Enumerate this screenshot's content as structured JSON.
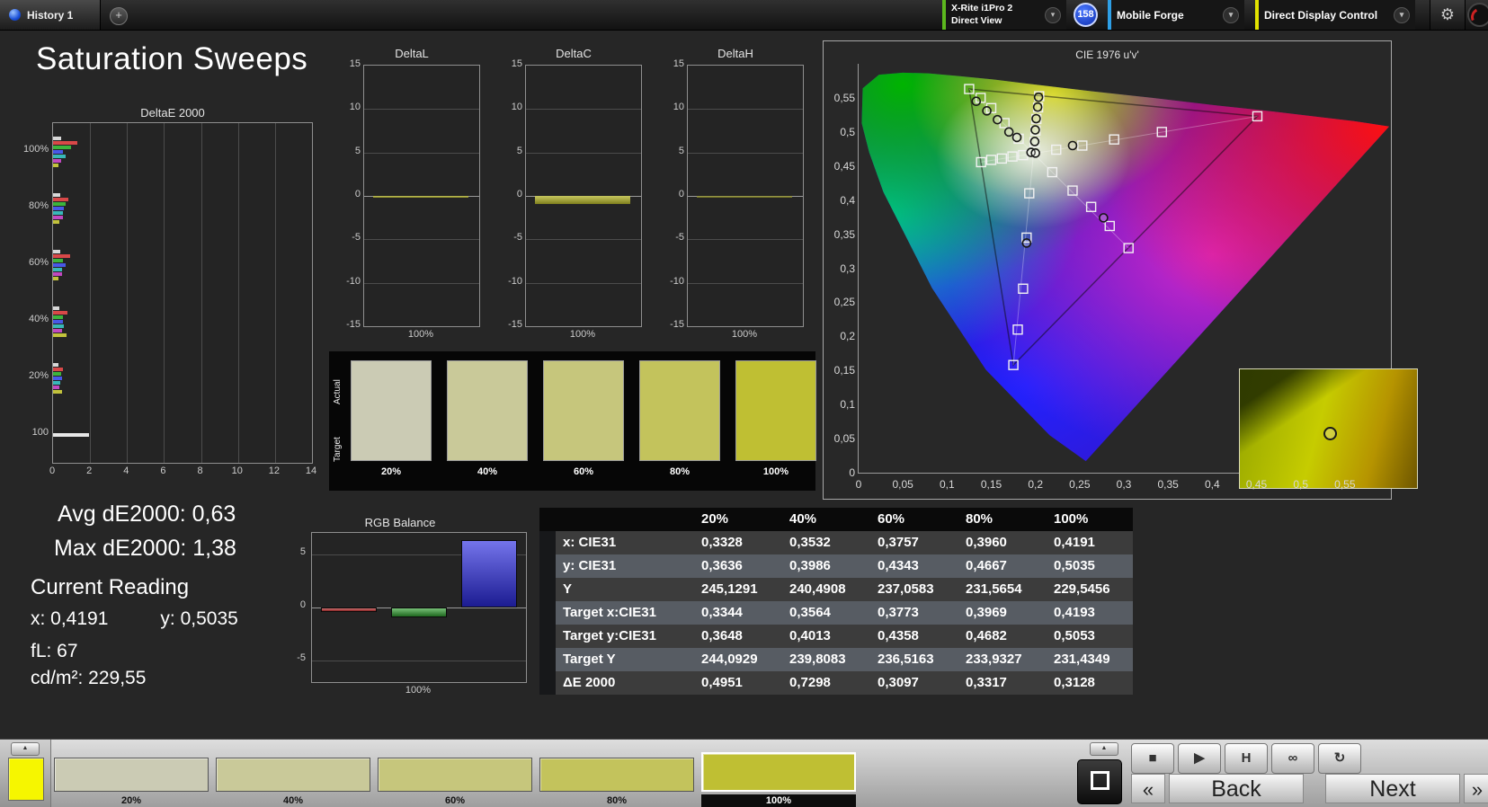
{
  "topbar": {
    "history_tab": "History 1",
    "add_tab_label": "+",
    "dropdown_chevron": "▾",
    "meter_dropdown": {
      "line1": "X-Rite i1Pro 2",
      "line2": "Direct View",
      "accent": "#5cb81e"
    },
    "reading_badge": "158",
    "source_dropdown": {
      "label": "Mobile Forge",
      "accent": "#2e9fe6"
    },
    "control_dropdown": {
      "label": "Direct Display Control",
      "accent": "#e3e300"
    },
    "gear_icon": "⚙"
  },
  "page_title": "Saturation Sweeps",
  "readings": {
    "avg": "Avg dE2000: 0,63",
    "max": "Max dE2000: 1,38",
    "heading": "Current Reading",
    "x": "x: 0,4191",
    "y": "y: 0,5035",
    "fl": "fL: 67",
    "cdm2": "cd/m²: 229,55"
  },
  "saturation_swatches": {
    "actual_label": "Actual",
    "target_label": "Target",
    "labels": [
      "20%",
      "40%",
      "60%",
      "80%",
      "100%"
    ],
    "colors": [
      "#cbcbb4",
      "#c9c999",
      "#c6c67c",
      "#c3c35c",
      "#bfbf33"
    ]
  },
  "results_table": {
    "headers": [
      "20%",
      "40%",
      "60%",
      "80%",
      "100%"
    ],
    "rows": [
      {
        "label": "x: CIE31",
        "values": [
          "0,3328",
          "0,3532",
          "0,3757",
          "0,3960",
          "0,4191"
        ]
      },
      {
        "label": "y: CIE31",
        "values": [
          "0,3636",
          "0,3986",
          "0,4343",
          "0,4667",
          "0,5035"
        ]
      },
      {
        "label": "Y",
        "values": [
          "245,1291",
          "240,4908",
          "237,0583",
          "231,5654",
          "229,5456"
        ]
      },
      {
        "label": "Target x:CIE31",
        "values": [
          "0,3344",
          "0,3564",
          "0,3773",
          "0,3969",
          "0,4193"
        ]
      },
      {
        "label": "Target y:CIE31",
        "values": [
          "0,3648",
          "0,4013",
          "0,4358",
          "0,4682",
          "0,5053"
        ]
      },
      {
        "label": "Target Y",
        "values": [
          "244,0929",
          "239,8083",
          "236,5163",
          "233,9327",
          "231,4349"
        ]
      },
      {
        "label": "ΔE 2000",
        "values": [
          "0,4951",
          "0,7298",
          "0,3097",
          "0,3317",
          "0,3128"
        ]
      }
    ]
  },
  "bottom_bar": {
    "current_color": "#f6f600",
    "up_arrow": "▲",
    "swatches": [
      {
        "label": "20%",
        "color": "#cbcbb4",
        "selected": false
      },
      {
        "label": "40%",
        "color": "#c9c999",
        "selected": false
      },
      {
        "label": "60%",
        "color": "#c6c67c",
        "selected": false
      },
      {
        "label": "80%",
        "color": "#c3c35c",
        "selected": false
      },
      {
        "label": "100%",
        "color": "#bfbf33",
        "selected": true
      }
    ],
    "transport": [
      {
        "name": "stop",
        "glyph": "■"
      },
      {
        "name": "play",
        "glyph": "▶"
      },
      {
        "name": "pause",
        "glyph": "H"
      },
      {
        "name": "continuous",
        "glyph": "∞"
      },
      {
        "name": "refresh",
        "glyph": "↻"
      }
    ],
    "stop_square": "■",
    "prev_chevron": "«",
    "back": "Back",
    "next": "Next",
    "next_chevron": "»"
  },
  "chart_data": [
    {
      "type": "bar",
      "title": "DeltaE 2000",
      "orientation": "horizontal",
      "xlim": [
        0,
        14
      ],
      "x_ticks": [
        0,
        2,
        4,
        6,
        8,
        10,
        12,
        14
      ],
      "series_colors": [
        "#d8d8d8",
        "#d84848",
        "#3cb43c",
        "#4858e8",
        "#38b8b8",
        "#c048c0",
        "#c2c23c"
      ],
      "groups": [
        {
          "label": "100%",
          "values": [
            0.45,
            1.31,
            0.95,
            0.52,
            0.68,
            0.42,
            0.31
          ]
        },
        {
          "label": "80%",
          "values": [
            0.4,
            0.85,
            0.7,
            0.6,
            0.52,
            0.55,
            0.33
          ]
        },
        {
          "label": "60%",
          "values": [
            0.38,
            0.92,
            0.55,
            0.66,
            0.48,
            0.5,
            0.31
          ]
        },
        {
          "label": "40%",
          "values": [
            0.35,
            0.78,
            0.52,
            0.55,
            0.58,
            0.47,
            0.73
          ]
        },
        {
          "label": "20%",
          "values": [
            0.3,
            0.55,
            0.42,
            0.48,
            0.4,
            0.33,
            0.5
          ]
        },
        {
          "label": "100",
          "values": [
            1.95
          ]
        }
      ]
    },
    {
      "type": "bar",
      "title": "DeltaL",
      "ylim": [
        -15,
        15
      ],
      "y_ticks": [
        15,
        10,
        5,
        0,
        -5,
        -10,
        -15
      ],
      "categories": [
        "100%"
      ],
      "values": [
        -0.2
      ],
      "bar_color": "#b6b62a"
    },
    {
      "type": "bar",
      "title": "DeltaC",
      "ylim": [
        -15,
        15
      ],
      "y_ticks": [
        15,
        10,
        5,
        0,
        -5,
        -10,
        -15
      ],
      "categories": [
        "100%"
      ],
      "values": [
        -0.9
      ],
      "bar_color": "#b6b62a"
    },
    {
      "type": "bar",
      "title": "DeltaH",
      "ylim": [
        -15,
        15
      ],
      "y_ticks": [
        15,
        10,
        5,
        0,
        -5,
        -10,
        -15
      ],
      "categories": [
        "100%"
      ],
      "values": [
        -0.15
      ],
      "bar_color": "#8a8a20"
    },
    {
      "type": "bar",
      "title": "RGB Balance",
      "ylim": [
        -7,
        7
      ],
      "y_ticks": [
        5,
        0,
        -5
      ],
      "categories": [
        "100%"
      ],
      "series": [
        {
          "name": "Red",
          "value": -0.4,
          "color": "#c43030"
        },
        {
          "name": "Green",
          "value": -0.9,
          "color": "#2f9e2f"
        },
        {
          "name": "Blue",
          "value": 6.3,
          "color": "#2a2ae0"
        }
      ]
    },
    {
      "type": "scatter",
      "title": "CIE 1976 u'v'",
      "xlim": [
        0,
        0.6
      ],
      "ylim": [
        0,
        0.6
      ],
      "tick_values": [
        0,
        0.05,
        0.1,
        0.15,
        0.2,
        0.25,
        0.3,
        0.35,
        0.4,
        0.45,
        0.5,
        0.55
      ],
      "tick_labels": [
        "0",
        "0,05",
        "0,1",
        "0,15",
        "0,2",
        "0,25",
        "0,3",
        "0,35",
        "0,4",
        "0,45",
        "0,5",
        "0,55"
      ],
      "white_point": [
        0.1978,
        0.4683
      ],
      "gamut_triangle": [
        [
          0.451,
          0.523
        ],
        [
          0.125,
          0.563
        ],
        [
          0.175,
          0.158
        ]
      ],
      "sweep_endpoints": [
        [
          0.451,
          0.523
        ],
        [
          0.125,
          0.563
        ],
        [
          0.175,
          0.158
        ],
        [
          0.1385,
          0.4557
        ],
        [
          0.3053,
          0.3296
        ],
        [
          0.2042,
          0.5524
        ]
      ],
      "target_points": [
        [
          0.2235,
          0.474
        ],
        [
          0.253,
          0.48
        ],
        [
          0.289,
          0.489
        ],
        [
          0.343,
          0.5
        ],
        [
          0.451,
          0.523
        ],
        [
          0.181,
          0.49
        ],
        [
          0.165,
          0.513
        ],
        [
          0.15,
          0.535
        ],
        [
          0.138,
          0.55
        ],
        [
          0.125,
          0.563
        ],
        [
          0.193,
          0.41
        ],
        [
          0.19,
          0.345
        ],
        [
          0.186,
          0.27
        ],
        [
          0.18,
          0.21
        ],
        [
          0.175,
          0.158
        ],
        [
          0.186,
          0.466
        ],
        [
          0.174,
          0.464
        ],
        [
          0.162,
          0.461
        ],
        [
          0.15,
          0.459
        ],
        [
          0.1385,
          0.4557
        ],
        [
          0.219,
          0.441
        ],
        [
          0.242,
          0.414
        ],
        [
          0.263,
          0.39
        ],
        [
          0.284,
          0.362
        ],
        [
          0.3053,
          0.3296
        ],
        [
          0.199,
          0.485
        ],
        [
          0.2,
          0.502
        ],
        [
          0.201,
          0.519
        ],
        [
          0.203,
          0.536
        ],
        [
          0.2042,
          0.5524
        ]
      ],
      "measured_points": [
        [
          0.2035,
          0.551
        ],
        [
          0.2025,
          0.5365
        ],
        [
          0.2008,
          0.5195
        ],
        [
          0.1998,
          0.503
        ],
        [
          0.1992,
          0.486
        ],
        [
          0.133,
          0.545
        ],
        [
          0.145,
          0.531
        ],
        [
          0.157,
          0.518
        ],
        [
          0.17,
          0.5
        ],
        [
          0.179,
          0.492
        ],
        [
          0.242,
          0.48
        ],
        [
          0.277,
          0.374
        ],
        [
          0.19,
          0.337
        ],
        [
          0.195,
          0.47
        ],
        [
          0.2,
          0.469
        ]
      ],
      "inset_marker": [
        0.5,
        0.53
      ]
    }
  ]
}
